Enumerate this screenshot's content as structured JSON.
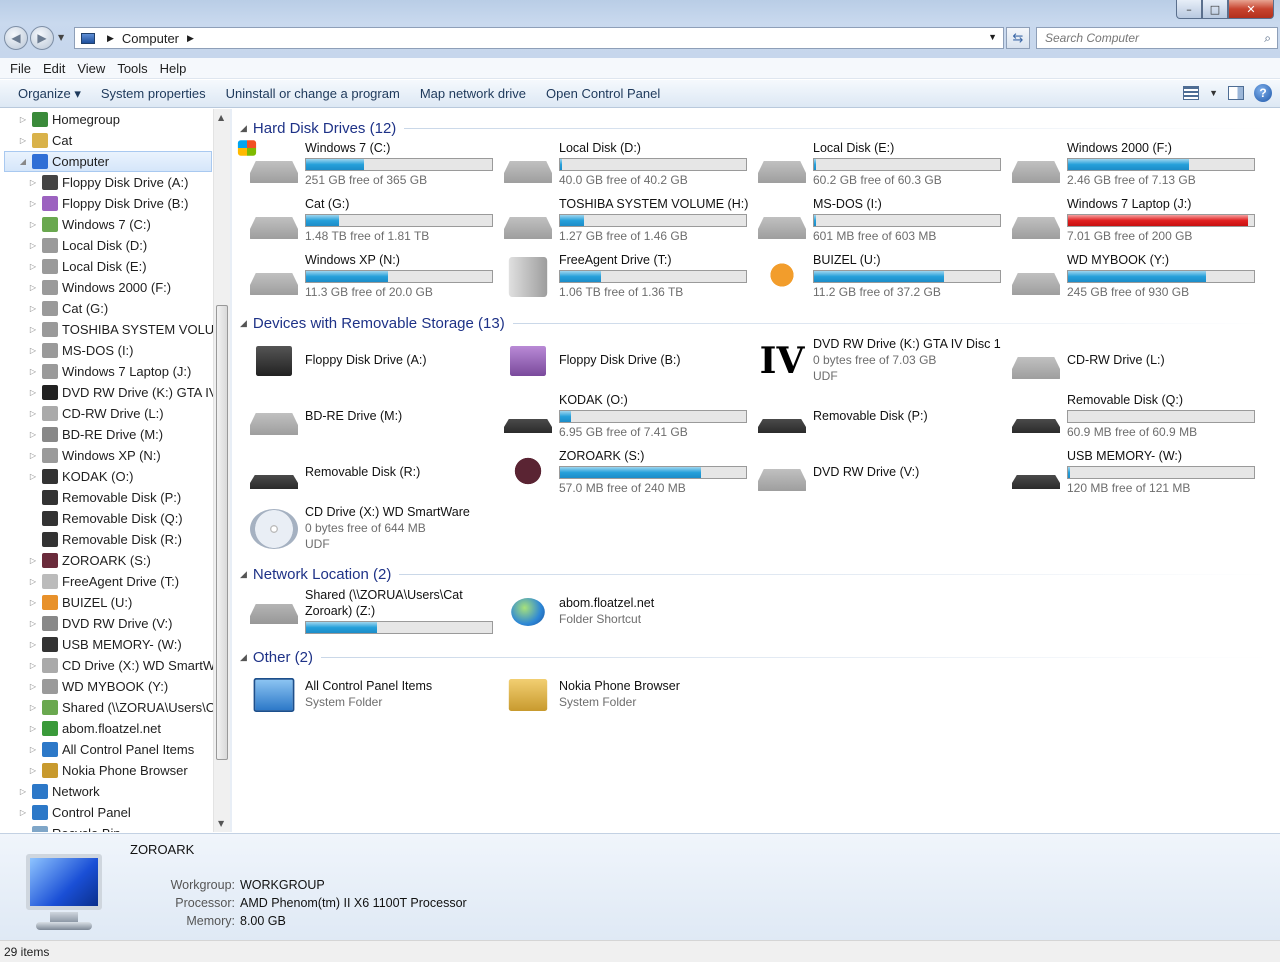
{
  "window": {
    "min_label": "–",
    "max_label": "□",
    "close_label": "✕"
  },
  "address": {
    "path": "Computer",
    "search_placeholder": "Search Computer"
  },
  "menu": [
    "File",
    "Edit",
    "View",
    "Tools",
    "Help"
  ],
  "commands": [
    "Organize ▾",
    "System properties",
    "Uninstall or change a program",
    "Map network drive",
    "Open Control Panel"
  ],
  "nav": {
    "items": [
      {
        "label": "Homegroup",
        "level": 1,
        "arrow": "▷",
        "icon": "homegroup-icon",
        "color": "#3a8a3a"
      },
      {
        "label": "Cat",
        "level": 1,
        "arrow": "▷",
        "icon": "user-folder-icon",
        "color": "#d9b24a"
      },
      {
        "label": "Computer",
        "level": 1,
        "arrow": "◢",
        "icon": "computer-icon",
        "color": "#2f6fd6",
        "selected": true
      },
      {
        "label": "Floppy Disk Drive (A:)",
        "level": 2,
        "arrow": "▷",
        "icon": "floppy-icon",
        "color": "#444"
      },
      {
        "label": "Floppy Disk Drive (B:)",
        "level": 2,
        "arrow": "▷",
        "icon": "floppy-icon",
        "color": "#9c62c0"
      },
      {
        "label": "Windows 7 (C:)",
        "level": 2,
        "arrow": "▷",
        "icon": "windows-drive-icon",
        "color": "#6aa84f"
      },
      {
        "label": "Local Disk (D:)",
        "level": 2,
        "arrow": "▷",
        "icon": "hdd-icon",
        "color": "#9a9a9a"
      },
      {
        "label": "Local Disk (E:)",
        "level": 2,
        "arrow": "▷",
        "icon": "hdd-icon",
        "color": "#9a9a9a"
      },
      {
        "label": "Windows 2000 (F:)",
        "level": 2,
        "arrow": "▷",
        "icon": "hdd-icon",
        "color": "#9a9a9a"
      },
      {
        "label": "Cat (G:)",
        "level": 2,
        "arrow": "▷",
        "icon": "hdd-icon",
        "color": "#9a9a9a"
      },
      {
        "label": "TOSHIBA SYSTEM VOLUME (",
        "level": 2,
        "arrow": "▷",
        "icon": "hdd-icon",
        "color": "#9a9a9a"
      },
      {
        "label": "MS-DOS (I:)",
        "level": 2,
        "arrow": "▷",
        "icon": "hdd-icon",
        "color": "#9a9a9a"
      },
      {
        "label": "Windows 7 Laptop (J:)",
        "level": 2,
        "arrow": "▷",
        "icon": "hdd-icon",
        "color": "#9a9a9a"
      },
      {
        "label": "DVD RW Drive (K:) GTA IV Dis",
        "level": 2,
        "arrow": "▷",
        "icon": "gta-iv-icon",
        "color": "#222"
      },
      {
        "label": "CD-RW Drive (L:)",
        "level": 2,
        "arrow": "▷",
        "icon": "cd-drive-icon",
        "color": "#aaa"
      },
      {
        "label": "BD-RE Drive (M:)",
        "level": 2,
        "arrow": "▷",
        "icon": "bd-drive-icon",
        "color": "#888"
      },
      {
        "label": "Windows XP (N:)",
        "level": 2,
        "arrow": "▷",
        "icon": "hdd-icon",
        "color": "#9a9a9a"
      },
      {
        "label": "KODAK (O:)",
        "level": 2,
        "arrow": "▷",
        "icon": "removable-icon",
        "color": "#333"
      },
      {
        "label": "Removable Disk (P:)",
        "level": 2,
        "arrow": "",
        "icon": "removable-icon",
        "color": "#333"
      },
      {
        "label": "Removable Disk (Q:)",
        "level": 2,
        "arrow": "",
        "icon": "removable-icon",
        "color": "#333"
      },
      {
        "label": "Removable Disk (R:)",
        "level": 2,
        "arrow": "",
        "icon": "removable-icon",
        "color": "#333"
      },
      {
        "label": "ZOROARK (S:)",
        "level": 2,
        "arrow": "▷",
        "icon": "zoroark-icon",
        "color": "#6a2b3b"
      },
      {
        "label": "FreeAgent Drive (T:)",
        "level": 2,
        "arrow": "▷",
        "icon": "external-drive-icon",
        "color": "#bbb"
      },
      {
        "label": "BUIZEL (U:)",
        "level": 2,
        "arrow": "▷",
        "icon": "buizel-icon",
        "color": "#e8912a"
      },
      {
        "label": "DVD RW Drive (V:)",
        "level": 2,
        "arrow": "▷",
        "icon": "dvd-drive-icon",
        "color": "#888"
      },
      {
        "label": "USB MEMORY- (W:)",
        "level": 2,
        "arrow": "▷",
        "icon": "removable-icon",
        "color": "#333"
      },
      {
        "label": "CD Drive (X:) WD SmartWare",
        "level": 2,
        "arrow": "▷",
        "icon": "cd-drive-icon",
        "color": "#aaa"
      },
      {
        "label": "WD MYBOOK (Y:)",
        "level": 2,
        "arrow": "▷",
        "icon": "hdd-icon",
        "color": "#9a9a9a"
      },
      {
        "label": "Shared (\\\\ZORUA\\Users\\Cat",
        "level": 2,
        "arrow": "▷",
        "icon": "network-drive-icon",
        "color": "#6aa84f"
      },
      {
        "label": "abom.floatzel.net",
        "level": 2,
        "arrow": "▷",
        "icon": "globe-icon",
        "color": "#3a9a3a"
      },
      {
        "label": "All Control Panel Items",
        "level": 2,
        "arrow": "▷",
        "icon": "control-panel-icon",
        "color": "#2c78c8"
      },
      {
        "label": "Nokia Phone Browser",
        "level": 2,
        "arrow": "▷",
        "icon": "nokia-icon",
        "color": "#c89a2e"
      },
      {
        "label": "Network",
        "level": 1,
        "arrow": "▷",
        "icon": "network-icon",
        "color": "#2c78c8"
      },
      {
        "label": "Control Panel",
        "level": 1,
        "arrow": "▷",
        "icon": "control-panel-icon",
        "color": "#2c78c8"
      },
      {
        "label": "Recycle Bin",
        "level": 1,
        "arrow": "",
        "icon": "recycle-bin-icon",
        "color": "#7fa6c8"
      }
    ]
  },
  "groups": [
    {
      "label": "Hard Disk Drives (12)",
      "items": [
        {
          "name": "Windows 7 (C:)",
          "free": "251 GB free of 365 GB",
          "used": 0.31,
          "icon": "windows-drive-icon"
        },
        {
          "name": "Local Disk (D:)",
          "free": "40.0 GB free of 40.2 GB",
          "used": 0.01,
          "icon": "hdd-icon"
        },
        {
          "name": "Local Disk (E:)",
          "free": "60.2 GB free of 60.3 GB",
          "used": 0.01,
          "icon": "hdd-icon"
        },
        {
          "name": "Windows 2000 (F:)",
          "free": "2.46 GB free of 7.13 GB",
          "used": 0.65,
          "icon": "hdd-icon"
        },
        {
          "name": "Cat (G:)",
          "free": "1.48 TB free of 1.81 TB",
          "used": 0.18,
          "icon": "hdd-icon"
        },
        {
          "name": "TOSHIBA SYSTEM VOLUME (H:)",
          "free": "1.27 GB free of 1.46 GB",
          "used": 0.13,
          "icon": "hdd-icon"
        },
        {
          "name": "MS-DOS (I:)",
          "free": "601 MB free of 603 MB",
          "used": 0.01,
          "icon": "hdd-icon"
        },
        {
          "name": "Windows 7 Laptop (J:)",
          "free": "7.01 GB free of 200 GB",
          "used": 0.97,
          "red": true,
          "icon": "hdd-icon"
        },
        {
          "name": "Windows XP (N:)",
          "free": "11.3 GB free of 20.0 GB",
          "used": 0.44,
          "icon": "hdd-icon"
        },
        {
          "name": "FreeAgent Drive (T:)",
          "free": "1.06 TB free of 1.36 TB",
          "used": 0.22,
          "icon": "external-drive-icon"
        },
        {
          "name": "BUIZEL (U:)",
          "free": "11.2 GB free of 37.2 GB",
          "used": 0.7,
          "icon": "buizel-icon"
        },
        {
          "name": "WD MYBOOK (Y:)",
          "free": "245 GB free of 930 GB",
          "used": 0.74,
          "icon": "hdd-icon"
        }
      ]
    },
    {
      "label": "Devices with Removable Storage (13)",
      "items": [
        {
          "name": "Floppy Disk Drive (A:)",
          "icon": "floppy-icon"
        },
        {
          "name": "Floppy Disk Drive (B:)",
          "icon": "floppy-purple-icon"
        },
        {
          "name": "DVD RW Drive (K:) GTA IV Disc 1",
          "sub1": "0 bytes free of 7.03 GB",
          "sub2": "UDF",
          "icon": "gta-iv-icon"
        },
        {
          "name": "CD-RW Drive (L:)",
          "icon": "cd-drive-icon"
        },
        {
          "name": "BD-RE Drive (M:)",
          "icon": "bd-drive-icon"
        },
        {
          "name": "KODAK (O:)",
          "free": "6.95 GB free of 7.41 GB",
          "used": 0.06,
          "icon": "removable-icon"
        },
        {
          "name": "Removable Disk (P:)",
          "icon": "removable-icon"
        },
        {
          "name": "Removable Disk (Q:)",
          "free": "60.9 MB free of 60.9 MB",
          "used": 0.0,
          "icon": "removable-icon"
        },
        {
          "name": "Removable Disk (R:)",
          "icon": "removable-icon"
        },
        {
          "name": "ZOROARK (S:)",
          "free": "57.0 MB free of 240 MB",
          "used": 0.76,
          "icon": "zoroark-icon"
        },
        {
          "name": "DVD RW Drive (V:)",
          "icon": "dvd-drive-icon"
        },
        {
          "name": "USB MEMORY- (W:)",
          "free": "120 MB free of 121 MB",
          "used": 0.01,
          "icon": "removable-icon"
        },
        {
          "name": "CD Drive (X:) WD SmartWare",
          "sub1": "0 bytes free of 644 MB",
          "sub2": "UDF",
          "icon": "cd-icon"
        }
      ]
    },
    {
      "label": "Network Location (2)",
      "items": [
        {
          "name": "Shared (\\\\ZORUA\\Users\\Cat",
          "name2": "Zoroark) (Z:)",
          "used": 0.38,
          "icon": "network-drive-icon"
        },
        {
          "name": "abom.floatzel.net",
          "sub1": "Folder Shortcut",
          "icon": "globe-icon"
        }
      ]
    },
    {
      "label": "Other (2)",
      "items": [
        {
          "name": "All Control Panel Items",
          "sub1": "System Folder",
          "icon": "control-panel-icon"
        },
        {
          "name": "Nokia Phone Browser",
          "sub1": "System Folder",
          "icon": "nokia-icon"
        }
      ]
    }
  ],
  "details": {
    "name": "ZOROARK",
    "rows": [
      {
        "label": "Workgroup:",
        "value": "WORKGROUP"
      },
      {
        "label": "Processor:",
        "value": "AMD Phenom(tm) II X6 1100T Processor"
      },
      {
        "label": "Memory:",
        "value": "8.00 GB"
      }
    ]
  },
  "status": "29 items"
}
